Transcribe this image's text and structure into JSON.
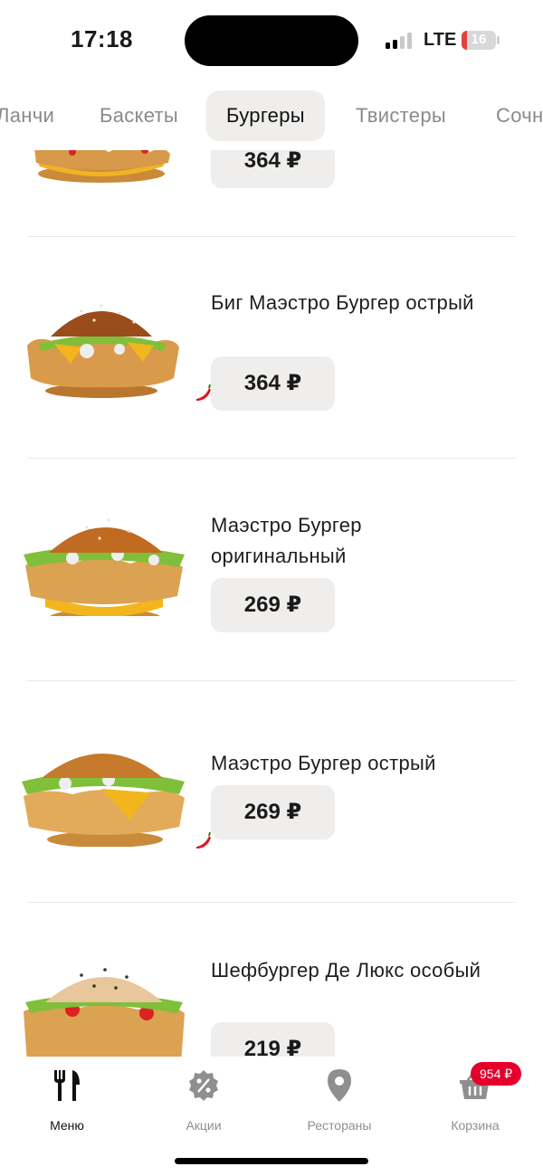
{
  "status_bar": {
    "time": "17:18",
    "network": "LTE",
    "battery": "16",
    "battery_level": 0.16
  },
  "categories": [
    {
      "label": "Ланчи",
      "active": false
    },
    {
      "label": "Баскеты",
      "active": false
    },
    {
      "label": "Бургеры",
      "active": true
    },
    {
      "label": "Твистеры",
      "active": false
    },
    {
      "label": "Сочн",
      "active": false
    }
  ],
  "products": [
    {
      "name": "",
      "price": "364 ₽",
      "spicy": false
    },
    {
      "name": "Биг Маэстро Бургер острый",
      "price": "364 ₽",
      "spicy": true
    },
    {
      "name": "Маэстро Бургер оригинальный",
      "price": "269 ₽",
      "spicy": false
    },
    {
      "name": "Маэстро Бургер острый",
      "price": "269 ₽",
      "spicy": true
    },
    {
      "name": "Шефбургер Де Люкс особый",
      "price": "219 ₽",
      "spicy": false
    }
  ],
  "bottom_nav": {
    "items": [
      {
        "label": "Меню",
        "icon": "fork-knife-icon",
        "active": true
      },
      {
        "label": "Акции",
        "icon": "discount-badge-icon",
        "active": false
      },
      {
        "label": "Рестораны",
        "icon": "map-pin-icon",
        "active": false
      },
      {
        "label": "Корзина",
        "icon": "basket-icon",
        "active": false
      }
    ],
    "cart_total": "954 ₽"
  },
  "colors": {
    "accent": "#e4002b",
    "chip_bg": "#efeeec",
    "inactive_text": "#8a8a8a"
  }
}
